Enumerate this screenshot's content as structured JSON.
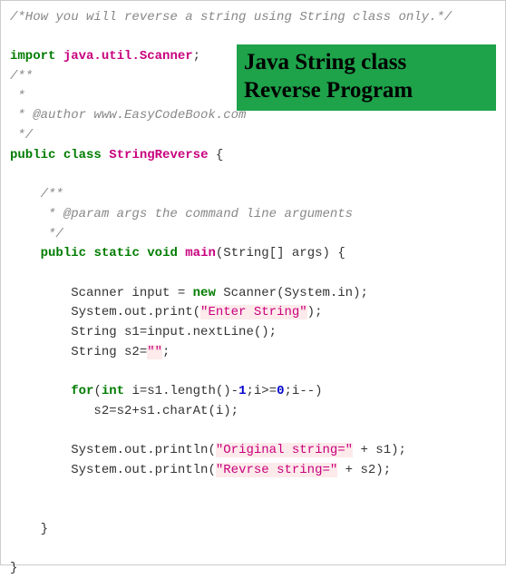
{
  "banner": {
    "line1": "Java String class",
    "line2": "Reverse Program"
  },
  "code": {
    "top_comment": "/*How you will reverse a string using String class only.*/",
    "import_kw": "import",
    "import_pkg": "java.util.Scanner",
    "doc1_open": "/**",
    "doc1_star": " *",
    "doc1_author": " * @author www.EasyCodeBook.com",
    "doc1_close": " */",
    "public_kw": "public",
    "class_kw": "class",
    "class_name": "StringReverse",
    "doc2_open": "/**",
    "doc2_param": " * @param args the command line arguments",
    "doc2_close": " */",
    "static_kw": "static",
    "void_kw": "void",
    "main_kw": "main",
    "main_params": "(String[] args) {",
    "scanner_decl_a": "Scanner input = ",
    "new_kw": "new",
    "scanner_decl_b": " Scanner(System.in);",
    "sysout_print": "System.out.print(",
    "str_enter": "\"Enter String\"",
    "close_paren_semi": ");",
    "s1_decl": "String s1=input.nextLine();",
    "s2_decl_a": "String s2=",
    "str_empty": "\"\"",
    "semi": ";",
    "for_kw": "for",
    "int_kw": "int",
    "for_a": "(",
    "for_b": " i=s1.length()-",
    "num_1": "1",
    "for_c": ";i>=",
    "num_0": "0",
    "for_d": ";i--)",
    "for_body": "   s2=s2+s1.charAt(i);",
    "sysout_println": "System.out.println(",
    "str_orig": "\"Original string=\"",
    "plus_s1": " + s1);",
    "str_rev": "\"Revrse string=\"",
    "plus_s2": " + s2);"
  }
}
